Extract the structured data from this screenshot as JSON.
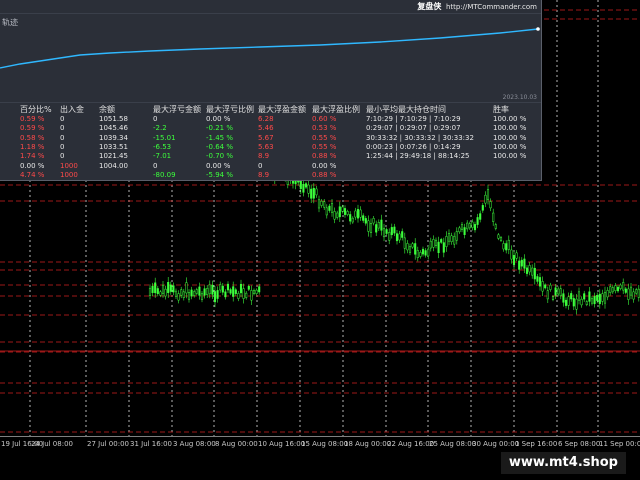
{
  "panel": {
    "brand_cn": "复盘侠",
    "brand_url": "http://MTCommander.com",
    "curve_title": "轨迹",
    "curve_date": "2023.10.03",
    "headers": [
      "百分比%",
      "出入金",
      "余额",
      "最大浮亏金额",
      "最大浮亏比例",
      "最大浮盈金额",
      "最大浮盈比例",
      "最小平均最大持仓时间",
      "胜率"
    ],
    "rows": [
      {
        "pct": "0.59 %",
        "dw": "0",
        "bal": "1051.58",
        "mfl": "0",
        "mflp": "0.00 %",
        "mfp": "6.28",
        "mfpp": "0.60 %",
        "time": "7:10:29 | 7:10:29 | 7:10:29",
        "win": "100.00 %",
        "pct_red": true,
        "dw_red": false,
        "green": false
      },
      {
        "pct": "0.59 %",
        "dw": "0",
        "bal": "1045.46",
        "mfl": "-2.2",
        "mflp": "-0.21 %",
        "mfp": "5.46",
        "mfpp": "0.53 %",
        "time": "0:29:07 | 0:29:07 | 0:29:07",
        "win": "100.00 %",
        "pct_red": true,
        "dw_red": false,
        "green": true
      },
      {
        "pct": "0.58 %",
        "dw": "0",
        "bal": "1039.34",
        "mfl": "-15.01",
        "mflp": "-1.45 %",
        "mfp": "5.67",
        "mfpp": "0.55 %",
        "time": "30:33:32 | 30:33:32 | 30:33:32",
        "win": "100.00 %",
        "pct_red": true,
        "dw_red": false,
        "green": true
      },
      {
        "pct": "1.18 %",
        "dw": "0",
        "bal": "1033.51",
        "mfl": "-6.53",
        "mflp": "-0.64 %",
        "mfp": "5.63",
        "mfpp": "0.55 %",
        "time": "0:00:23 | 0:07:26 | 0:14:29",
        "win": "100.00 %",
        "pct_red": true,
        "dw_red": false,
        "green": true
      },
      {
        "pct": "1.74 %",
        "dw": "0",
        "bal": "1021.45",
        "mfl": "-7.01",
        "mflp": "-0.70 %",
        "mfp": "8.9",
        "mfpp": "0.88 %",
        "time": "1:25:44 | 29:49:18 | 88:14:25",
        "win": "100.00 %",
        "pct_red": true,
        "dw_red": false,
        "green": true
      },
      {
        "pct": "0.00 %",
        "dw": "1000",
        "bal": "1004.00",
        "mfl": "0",
        "mflp": "0.00 %",
        "mfp": "0",
        "mfpp": "0.00 %",
        "time": "",
        "win": "",
        "pct_red": false,
        "dw_red": true,
        "green": false
      },
      {
        "pct": "4.74 %",
        "dw": "1000",
        "bal": "",
        "mfl": "-80.09",
        "mflp": "-5.94 %",
        "mfp": "8.9",
        "mfpp": "0.88 %",
        "time": "",
        "win": "",
        "pct_red": true,
        "dw_red": true,
        "green": true
      }
    ]
  },
  "time_axis": [
    "19 Jul 16:00",
    "24 Jul 08:00",
    "27 Jul 00:00",
    "31 Jul 16:00",
    "3 Aug 08:00",
    "8 Aug 00:00",
    "10 Aug 16:00",
    "15 Aug 08:00",
    "18 Aug 00:00",
    "22 Aug 16:00",
    "25 Aug 08:00",
    "30 Aug 00:00",
    "1 Sep 16:00",
    "6 Sep 08:00",
    "11 Sep 00:00"
  ],
  "watermark": "www.mt4.shop",
  "colors": {
    "background": "#000000",
    "panel_bg": "#2b2f38",
    "equity_line": "#2fb8ff",
    "candle": "#3cff3c",
    "level_red": "#d02020",
    "grid": "#ffffff",
    "negative_text": "#ff4a4a",
    "positive_text": "#3cff3c"
  }
}
